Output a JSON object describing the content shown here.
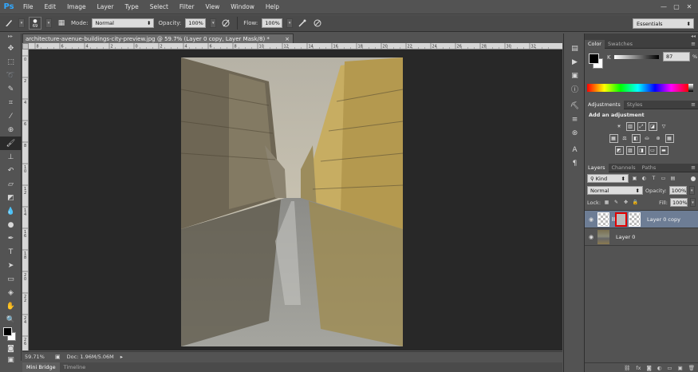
{
  "app": {
    "logo": "Ps"
  },
  "menu": [
    "File",
    "Edit",
    "Image",
    "Layer",
    "Type",
    "Select",
    "Filter",
    "View",
    "Window",
    "Help"
  ],
  "window_controls": [
    "—",
    "▢",
    "✕"
  ],
  "options": {
    "brush_size": "69",
    "mode_label": "Mode:",
    "mode_value": "Normal",
    "opacity_label": "Opacity:",
    "opacity_value": "100%",
    "flow_label": "Flow:",
    "flow_value": "100%",
    "workspace": "Essentials"
  },
  "document": {
    "tab_title": "architecture-avenue-buildings-city-preview.jpg @ 59.7% (Layer 0 copy, Layer Mask/8) *",
    "close": "×",
    "ruler_ticks": [
      "8",
      "6",
      "4",
      "2",
      "0",
      "2",
      "4",
      "6",
      "8",
      "10",
      "12",
      "14",
      "16",
      "18",
      "20",
      "22",
      "24",
      "26",
      "28",
      "30",
      "32"
    ],
    "ruler_v_ticks": [
      "0",
      "2",
      "4",
      "6",
      "8",
      "1\n0",
      "1\n2",
      "1\n4",
      "1\n6",
      "1\n8",
      "2\n0",
      "2\n2",
      "2\n4",
      "2\n6"
    ]
  },
  "status": {
    "zoom": "59.71%",
    "doc": "Doc: 1.96M/5.06M"
  },
  "bottom_tabs": {
    "mini_bridge": "Mini Bridge",
    "timeline": "Timeline"
  },
  "color_panel": {
    "tab_color": "Color",
    "tab_swatches": "Swatches",
    "k_label": "K",
    "k_value": "87",
    "k_unit": "%"
  },
  "adjustments_panel": {
    "tab_adjustments": "Adjustments",
    "tab_styles": "Styles",
    "title": "Add an adjustment"
  },
  "layers_panel": {
    "tab_layers": "Layers",
    "tab_channels": "Channels",
    "tab_paths": "Paths",
    "filter_kind": "Kind",
    "blend_mode": "Normal",
    "opacity_label": "Opacity:",
    "opacity_value": "100%",
    "lock_label": "Lock:",
    "fill_label": "Fill:",
    "fill_value": "100%",
    "layers": [
      {
        "name": "Layer 0 copy",
        "selected": true
      },
      {
        "name": "Layer 0",
        "selected": false
      }
    ]
  }
}
